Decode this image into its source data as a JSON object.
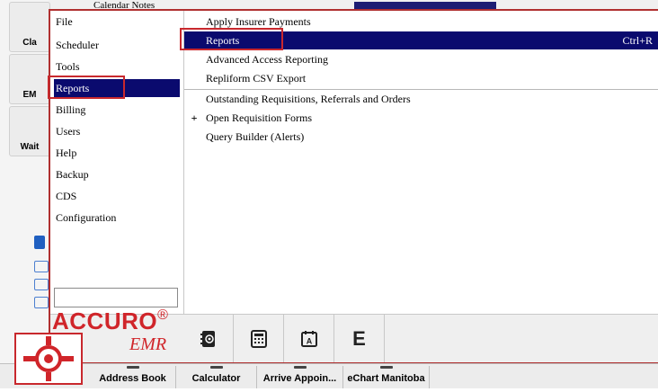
{
  "background": {
    "calendar_notes": "Calendar Notes",
    "tiles": [
      {
        "label": "Cla"
      },
      {
        "label": "EM"
      },
      {
        "label": "Wait"
      }
    ]
  },
  "menu": {
    "left_items": [
      {
        "label": "File",
        "active": false
      },
      {
        "label": "Scheduler",
        "active": false
      },
      {
        "label": "Tools",
        "active": false
      },
      {
        "label": "Reports",
        "active": true
      },
      {
        "label": "Billing",
        "active": false
      },
      {
        "label": "Users",
        "active": false
      },
      {
        "label": "Help",
        "active": false
      },
      {
        "label": "Backup",
        "active": false
      },
      {
        "label": "CDS",
        "active": false
      },
      {
        "label": "Configuration",
        "active": false
      }
    ],
    "search_value": "",
    "right_items": [
      {
        "label": "Apply Insurer Payments",
        "shortcut": "",
        "prefix": ""
      },
      {
        "label": "Reports",
        "shortcut": "Ctrl+R",
        "prefix": ""
      },
      {
        "label": "Advanced Access Reporting",
        "shortcut": "",
        "prefix": ""
      },
      {
        "label": "Repliform CSV Export",
        "shortcut": "",
        "prefix": ""
      },
      {
        "label": "Outstanding Requisitions, Referrals and Orders",
        "shortcut": "",
        "prefix": ""
      },
      {
        "label": "Open Requisition Forms",
        "shortcut": "",
        "prefix": "+"
      },
      {
        "label": "Query Builder (Alerts)",
        "shortcut": "",
        "prefix": ""
      }
    ]
  },
  "logo": {
    "brand": "ACCURO",
    "reg": "®",
    "sub": "EMR"
  },
  "quick_icons": [
    "address-book-icon",
    "calculator-icon",
    "arrive-appointment-icon",
    "echart-e-icon"
  ],
  "quick_icon_e": "E",
  "taskbar": [
    {
      "label": "Address Book"
    },
    {
      "label": "Calculator"
    },
    {
      "label": "Arrive Appoin..."
    },
    {
      "label": "eChart Manitoba"
    }
  ],
  "colors": {
    "highlight": "#0a0a6e",
    "accent_red": "#c8282d"
  }
}
